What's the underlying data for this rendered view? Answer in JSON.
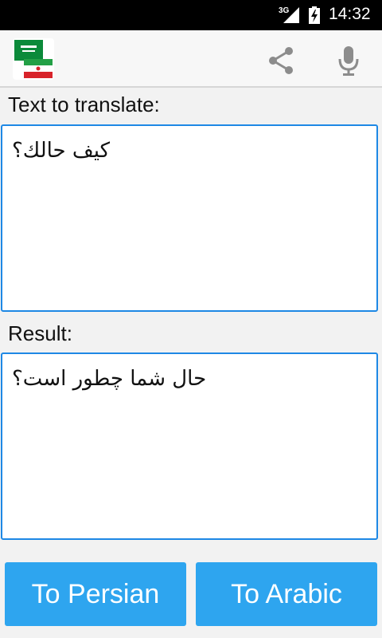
{
  "status_bar": {
    "network": "3G",
    "time": "14:32"
  },
  "app_bar": {
    "icons": [
      "saudi-iran-flags-icon",
      "share-icon",
      "microphone-icon"
    ]
  },
  "source": {
    "label": "Text to translate:",
    "text": "كيف حالك؟"
  },
  "result": {
    "label": "Result:",
    "text": "حال شما چطور است؟"
  },
  "buttons": {
    "to_persian": "To Persian",
    "to_arabic": "To Arabic"
  },
  "colors": {
    "accent": "#2ea5ef",
    "border": "#1e88e5",
    "saudi_green": "#0b8a3a",
    "iran_red": "#d8232a"
  }
}
